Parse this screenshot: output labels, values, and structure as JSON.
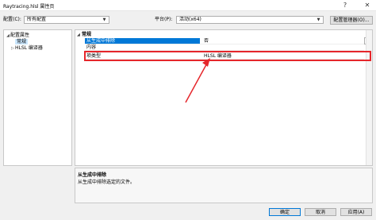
{
  "window": {
    "title": "Raytracing.hlsl 属性页",
    "help_button": "?",
    "close_button": "✕"
  },
  "config_bar": {
    "config_label": "配置(C):",
    "config_value": "所有配置",
    "platform_label": "平台(P):",
    "platform_value": "活动(x64)",
    "manager_button": "配置管理器(O)..."
  },
  "tree": {
    "items": [
      {
        "label": "配置属性",
        "expander": "◢"
      },
      {
        "label": "常规",
        "expander": ""
      },
      {
        "label": "HLSL 编译器",
        "expander": "▷"
      }
    ]
  },
  "grid": {
    "category": {
      "label": "常规",
      "expander": "◢"
    },
    "rows": [
      {
        "name": "从生成中排除",
        "value": "否"
      },
      {
        "name": "内容",
        "value": ""
      },
      {
        "name": "项类型",
        "value": "HLSL 编译器"
      }
    ],
    "dropdown_arrow": "⌄"
  },
  "description": {
    "title": "从生成中排除",
    "text": "从生成中排除选定的文件。"
  },
  "buttons": {
    "ok": "确定",
    "cancel": "取消",
    "apply": "应用(A)"
  },
  "colors": {
    "highlight_border": "#e5262b",
    "selection": "#0078d7",
    "tree_selection": "#cce8ff"
  }
}
